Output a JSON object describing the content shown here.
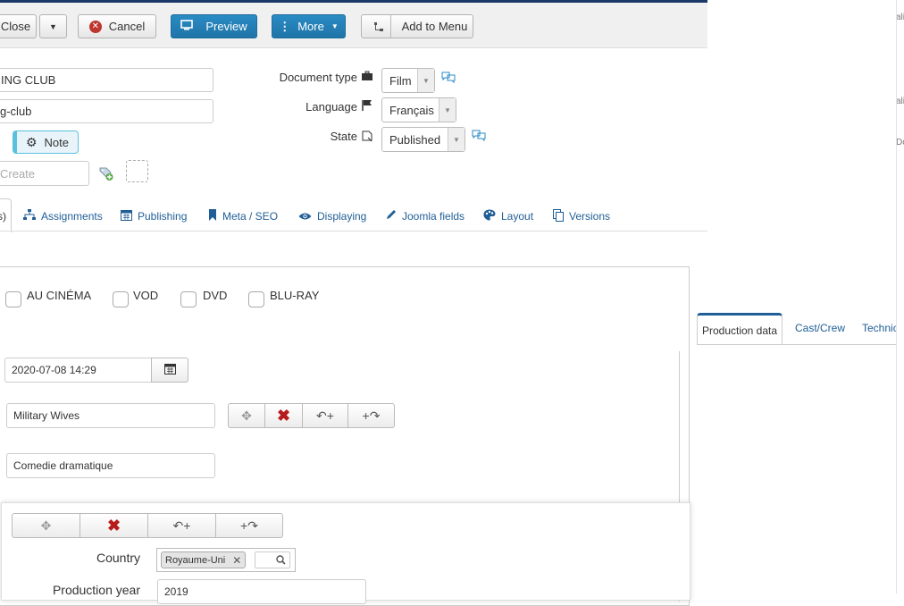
{
  "toolbar": {
    "close_label": "Close",
    "cancel_label": "Cancel",
    "preview_label": "Preview",
    "more_label": "More",
    "add_to_menu_label": "Add to Menu"
  },
  "form": {
    "title_value": "ING CLUB",
    "alias_value": "g-club",
    "note_button_label": "Note",
    "tags_placeholder": "Create"
  },
  "meta_fields": {
    "document_type_label": "Document type",
    "document_type_value": "Film",
    "language_label": "Language",
    "language_value": "Français",
    "state_label": "State",
    "state_value": "Published"
  },
  "tabs": [
    {
      "label": "s)"
    },
    {
      "label": "Assignments"
    },
    {
      "label": "Publishing"
    },
    {
      "label": "Meta / SEO"
    },
    {
      "label": "Displaying"
    },
    {
      "label": "Joomla fields"
    },
    {
      "label": "Layout"
    },
    {
      "label": "Versions"
    }
  ],
  "release": {
    "options": [
      "AU CINÉMA",
      "VOD",
      "DVD",
      "BLU-RAY"
    ],
    "date_value": "2020-07-08 14:29",
    "title_value": "Military Wives",
    "genre_value": "Comedie dramatique"
  },
  "subform": {
    "country_label": "Country",
    "country_tag": "Royaume-Uni",
    "production_year_label": "Production year",
    "production_year_value": "2019"
  },
  "right_tabs": [
    "Production data",
    "Cast/Crew",
    "Technic"
  ],
  "edge_snippets": [
    "ali",
    "ali",
    "Do"
  ],
  "colors": {
    "accent": "#2384d3",
    "topbar_border": "#1a3867",
    "link": "#1f5e96"
  }
}
